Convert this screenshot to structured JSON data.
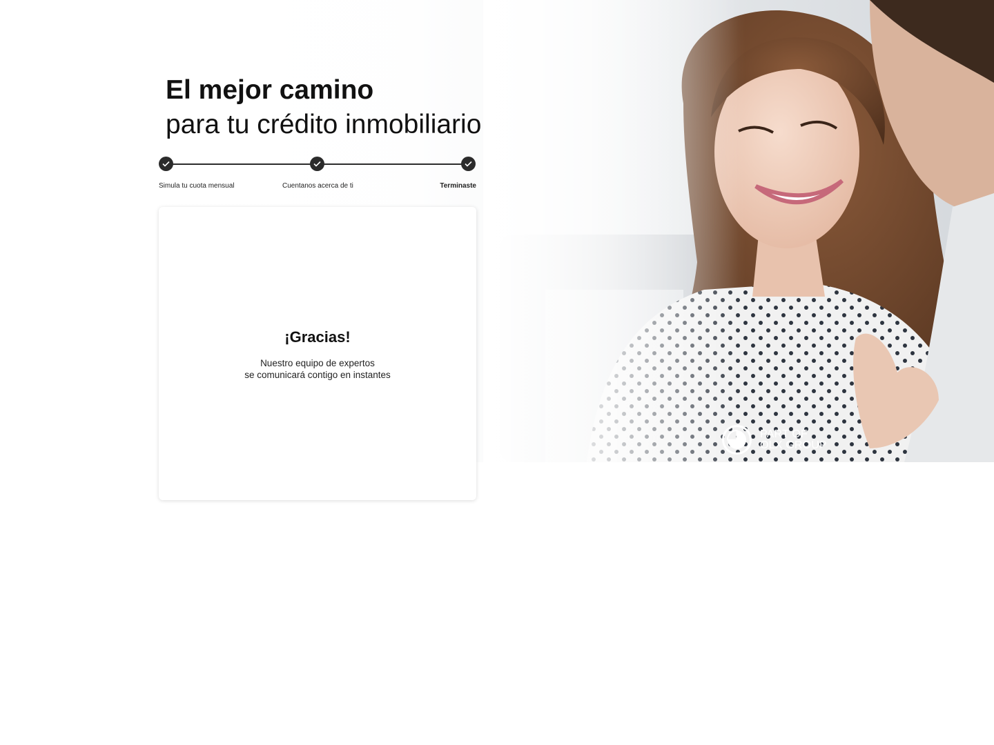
{
  "hero": {
    "title_bold": "El mejor camino",
    "title_light": "para tu crédito inmobiliario"
  },
  "stepper": {
    "steps": [
      {
        "label": "Simula tu cuota mensual",
        "status": "completed",
        "icon": "check-icon"
      },
      {
        "label": "Cuentanos acerca de ti",
        "status": "completed",
        "icon": "check-icon"
      },
      {
        "label": "Terminaste",
        "status": "current",
        "icon": "check-icon"
      }
    ],
    "color": "#2b2b2b"
  },
  "card": {
    "title": "¡Gracias!",
    "line1": "Nuestro equipo de expertos",
    "line2": "se comunicará contigo en instantes"
  },
  "badge": {
    "line1": "PART OF",
    "line2": "OLX GROUP",
    "icon": "olx-group-logo-icon"
  },
  "colors": {
    "accent": "#2b2b2b",
    "background": "#ffffff"
  }
}
